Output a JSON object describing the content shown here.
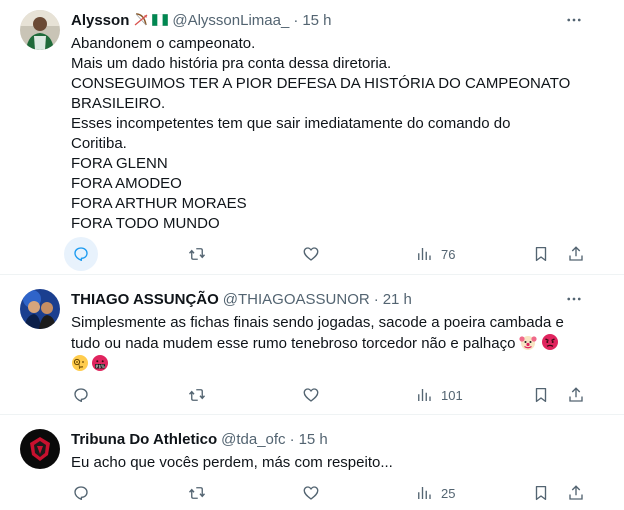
{
  "tweets": [
    {
      "name": "Alysson",
      "handle": "@AlyssonLimaa_",
      "dot": "·",
      "time": "15 h",
      "lines": [
        "Abandonem o campeonato.",
        "Mais um dado história pra conta dessa diretoria.",
        "CONSEGUIMOS TER A PIOR DEFESA DA HISTÓRIA DO CAMPEONATO",
        "BRASILEIRO.",
        "Esses incompetentes tem que sair imediatamente do comando do",
        "Coritiba.",
        "FORA GLENN",
        "FORA AMODEO",
        "FORA ARTHUR MORAES",
        "FORA TODO MUNDO"
      ],
      "views": "76"
    },
    {
      "name": "THIAGO ASSUNÇÃO",
      "handle": "@THIAGOASSUNOR",
      "dot": "·",
      "time": "21 h",
      "lines": [
        "Simplesmente as fichas finais sendo jogadas, sacode a poeira cambada e",
        "tudo ou nada mudem esse rumo tenebroso torcedor não e palhaço"
      ],
      "views": "101"
    },
    {
      "name": "Tribuna Do Athletico",
      "handle": "@tda_ofc",
      "dot": "·",
      "time": "15 h",
      "lines": [
        "Eu acho que vocês perdem, más com respeito..."
      ],
      "views": "25"
    }
  ],
  "icons": {
    "reply": "reply-icon",
    "retweet": "retweet-icon",
    "like": "like-icon",
    "views": "views-icon",
    "bookmark": "bookmark-icon",
    "share": "share-icon",
    "more": "more-icon"
  },
  "colors": {
    "text": "#0f1419",
    "secondary": "#536471",
    "accent": "#1d9bf0",
    "divider": "#eff3f4"
  }
}
